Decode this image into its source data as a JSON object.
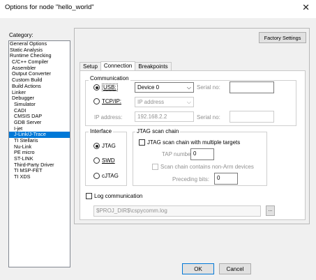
{
  "window": {
    "title": "Options for node \"hello_world\""
  },
  "category": {
    "label": "Category:",
    "items": [
      {
        "label": "General Options",
        "level": 0
      },
      {
        "label": "Static Analysis",
        "level": 0
      },
      {
        "label": "Runtime Checking",
        "level": 0
      },
      {
        "label": "C/C++ Compiler",
        "level": 1
      },
      {
        "label": "Assembler",
        "level": 1
      },
      {
        "label": "Output Converter",
        "level": 1
      },
      {
        "label": "Custom Build",
        "level": 1
      },
      {
        "label": "Build Actions",
        "level": 1
      },
      {
        "label": "Linker",
        "level": 1
      },
      {
        "label": "Debugger",
        "level": 1
      },
      {
        "label": "Simulator",
        "level": 2
      },
      {
        "label": "CADI",
        "level": 2
      },
      {
        "label": "CMSIS DAP",
        "level": 2
      },
      {
        "label": "GDB Server",
        "level": 2
      },
      {
        "label": "I-jet",
        "level": 2
      },
      {
        "label": "J-Link/J-Trace",
        "level": 2
      },
      {
        "label": "TI Stellaris",
        "level": 2
      },
      {
        "label": "Nu-Link",
        "level": 2
      },
      {
        "label": "PE micro",
        "level": 2
      },
      {
        "label": "ST-LINK",
        "level": 2
      },
      {
        "label": "Third-Party Driver",
        "level": 2
      },
      {
        "label": "TI MSP-FET",
        "level": 2
      },
      {
        "label": "TI XDS",
        "level": 2
      }
    ],
    "selected": "J-Link/J-Trace"
  },
  "factory_settings": "Factory Settings",
  "tabs": [
    "Setup",
    "Connection",
    "Breakpoints"
  ],
  "active_tab": "Connection",
  "communication": {
    "legend": "Communication",
    "usb": {
      "label": "USB:",
      "selected": true,
      "device": "Device 0",
      "serial_label": "Serial no:",
      "serial_value": ""
    },
    "tcpip": {
      "label": "TCP/IP:",
      "selected": false,
      "mode": "IP address",
      "ip_label": "IP address:",
      "ip_value": "192.168.2.2",
      "serial_label": "Serial no:",
      "serial_value": ""
    }
  },
  "interface": {
    "legend": "Interface",
    "options": [
      {
        "label": "JTAG",
        "selected": true
      },
      {
        "label": "SWD",
        "selected": false
      },
      {
        "label": "cJTAG",
        "selected": false
      }
    ]
  },
  "jtag_chain": {
    "legend": "JTAG scan chain",
    "multi_targets": "JTAG scan chain with multiple targets",
    "tap_label": "TAP number:",
    "tap_value": "0",
    "non_arm": "Scan chain contains non-Arm devices",
    "preceding_label": "Preceding bits:",
    "preceding_value": "0"
  },
  "log": {
    "label": "Log communication",
    "path": "$PROJ_DIR$\\cspycomm.log",
    "browse": "..."
  },
  "buttons": {
    "ok": "OK",
    "cancel": "Cancel"
  }
}
